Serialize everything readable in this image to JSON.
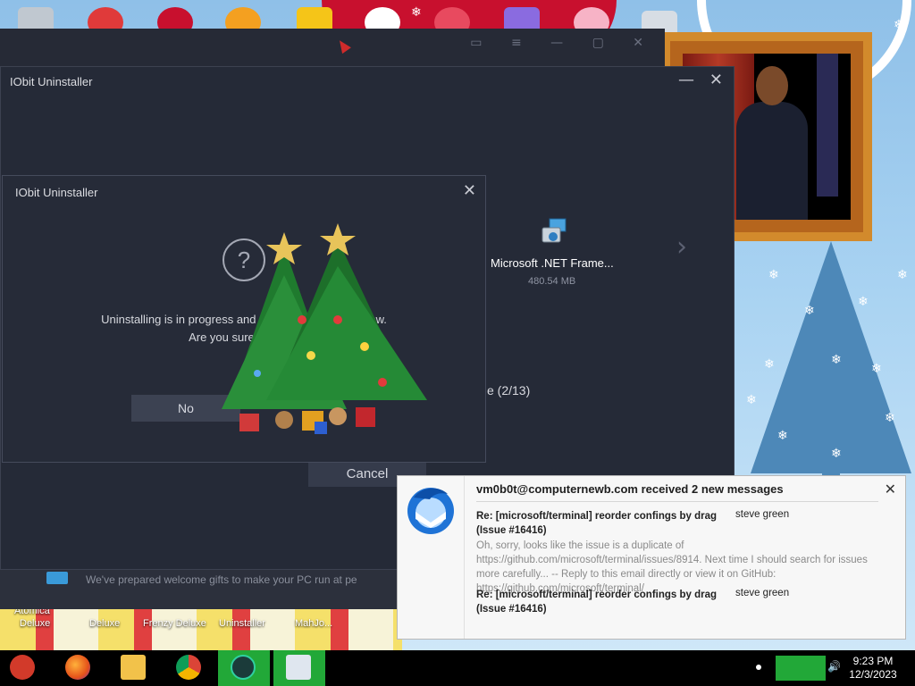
{
  "desktop": {
    "icon_labels": [
      "Atomica",
      "Deluxe",
      "Deluxe",
      "Frenzy Deluxe",
      "Uninstaller",
      "MahJo..."
    ]
  },
  "background_banner": {
    "text": "We've prepared welcome gifts to make your PC run at pe"
  },
  "main_window": {
    "title": "IObit Uninstaller",
    "minimize_glyph": "—",
    "close_glyph": "✕",
    "current_program": {
      "name": "Microsoft .NET Frame...",
      "size": "480.54 MB"
    },
    "next_glyph": "›",
    "progress_fragment": "e (2/13)",
    "cancel_label": "Cancel"
  },
  "dialog": {
    "title": "IObit Uninstaller",
    "close_glyph": "✕",
    "question_glyph": "?",
    "message_line1": "Uninstalling is in progress and resid",
    "message_line1_end": "exit now.",
    "message_line2": "Are you sure y",
    "no_label": "No"
  },
  "notification": {
    "heading": "vm0b0t@computernewb.com received 2 new messages",
    "close_glyph": "✕",
    "messages": [
      {
        "subject": "Re: [microsoft/terminal] reorder confings by drag (Issue #16416)",
        "sender": "steve green",
        "preview": "Oh, sorry, looks like the issue is a duplicate of https://github.com/microsoft/terminal/issues/8914. Next time I should search for issues more carefully... -- Reply to this email directly or view it on GitHub: https://github.com/microsoft/terminal/"
      },
      {
        "subject": "Re: [microsoft/terminal] reorder confings by drag (Issue #16416)",
        "sender": "steve green"
      }
    ]
  },
  "taskbar": {
    "apps": [
      "santa-start-icon",
      "firefox-icon",
      "file-explorer-icon",
      "chrome-icon",
      "iobit-uninstaller-icon",
      "control-panel-icon"
    ],
    "clock_time": "9:23 PM",
    "clock_date": "12/3/2023"
  },
  "colors": {
    "window_bg": "#252a37",
    "taskbar_active": "#22a838",
    "notification_bg": "#f7f7f7"
  }
}
